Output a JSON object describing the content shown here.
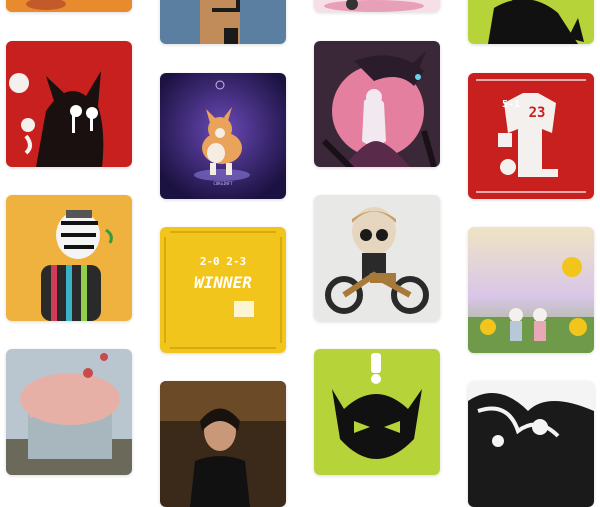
{
  "gallery": {
    "items": [
      {
        "name": "orange-sunset-art",
        "kind": "image"
      },
      {
        "name": "pixel-character-art",
        "kind": "image"
      },
      {
        "name": "pink-car-art",
        "kind": "image"
      },
      {
        "name": "green-cat-silhouette-art",
        "kind": "image"
      },
      {
        "name": "red-devil-cat-crying-art",
        "kind": "image"
      },
      {
        "name": "corgi-hologram-art",
        "kind": "image",
        "caption": "CORGINFT"
      },
      {
        "name": "dragon-girl-art",
        "kind": "image"
      },
      {
        "name": "red-sports-jersey-art",
        "kind": "image",
        "jersey_number": "23",
        "score": "5-1"
      },
      {
        "name": "zebra-sweater-character-art",
        "kind": "image"
      },
      {
        "name": "yellow-winner-poster-art",
        "kind": "image",
        "headline": "WINNER",
        "year": "2-0 2-3"
      },
      {
        "name": "skull-motorbike-art",
        "kind": "image"
      },
      {
        "name": "sunflower-field-couple-art",
        "kind": "image"
      },
      {
        "name": "melting-pink-building-art",
        "kind": "image"
      },
      {
        "name": "dark-portrait-art",
        "kind": "image"
      },
      {
        "name": "green-devil-cat-exclaim-art",
        "kind": "image"
      },
      {
        "name": "black-white-ink-art",
        "kind": "image"
      }
    ]
  },
  "colors": {
    "lime": "#b7d33a",
    "red": "#c8201f",
    "yellow": "#f2c51c",
    "purple": "#2b1a5e",
    "pink": "#e57fa0"
  }
}
